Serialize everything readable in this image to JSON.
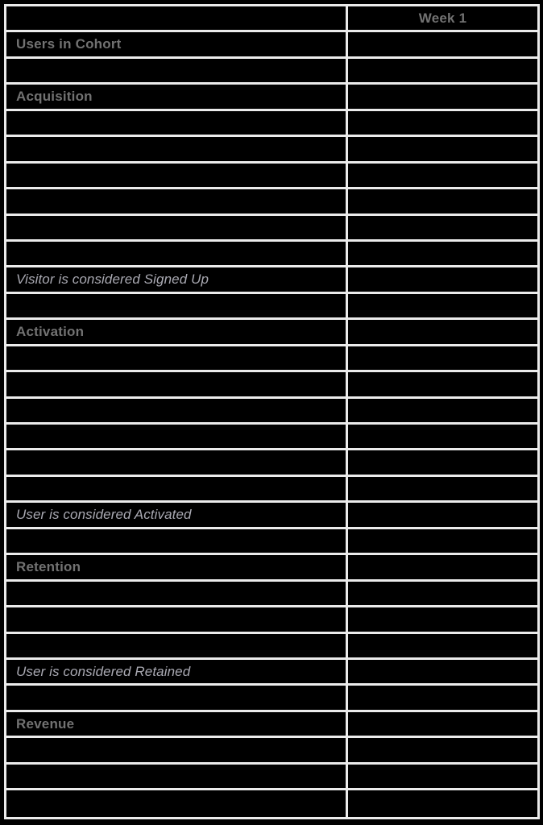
{
  "table": {
    "name": "cohort-funnel-metrics-table",
    "columns": [
      {
        "key": "label",
        "header": ""
      },
      {
        "key": "week1",
        "header": "Week 1"
      }
    ],
    "colors": {
      "background": "#000000",
      "gridline": "#ebebeb",
      "section_header_text": "#727272",
      "milestone_text": "#a9a9b2"
    },
    "rows": [
      {
        "style": "header",
        "label": "",
        "week1": "Week 1"
      },
      {
        "style": "section",
        "label": "Users in Cohort",
        "week1": ""
      },
      {
        "style": "blank",
        "label": "",
        "week1": ""
      },
      {
        "style": "section",
        "label": "Acquisition",
        "week1": ""
      },
      {
        "style": "blank",
        "label": "",
        "week1": ""
      },
      {
        "style": "blank",
        "label": "",
        "week1": ""
      },
      {
        "style": "blank",
        "label": "",
        "week1": ""
      },
      {
        "style": "blank",
        "label": "",
        "week1": ""
      },
      {
        "style": "blank",
        "label": "",
        "week1": ""
      },
      {
        "style": "blank",
        "label": "",
        "week1": ""
      },
      {
        "style": "milestone",
        "label": "Visitor is considered Signed Up",
        "week1": ""
      },
      {
        "style": "blank",
        "label": "",
        "week1": ""
      },
      {
        "style": "section",
        "label": "Activation",
        "week1": ""
      },
      {
        "style": "blank",
        "label": "",
        "week1": ""
      },
      {
        "style": "blank",
        "label": "",
        "week1": ""
      },
      {
        "style": "blank",
        "label": "",
        "week1": ""
      },
      {
        "style": "blank",
        "label": "",
        "week1": ""
      },
      {
        "style": "blank",
        "label": "",
        "week1": ""
      },
      {
        "style": "blank",
        "label": "",
        "week1": ""
      },
      {
        "style": "milestone",
        "label": "User is considered Activated",
        "week1": ""
      },
      {
        "style": "blank",
        "label": "",
        "week1": ""
      },
      {
        "style": "section",
        "label": "Retention",
        "week1": ""
      },
      {
        "style": "blank",
        "label": "",
        "week1": ""
      },
      {
        "style": "blank",
        "label": "",
        "week1": ""
      },
      {
        "style": "blank",
        "label": "",
        "week1": ""
      },
      {
        "style": "milestone",
        "label": "User is considered Retained",
        "week1": ""
      },
      {
        "style": "blank",
        "label": "",
        "week1": ""
      },
      {
        "style": "section",
        "label": "Revenue",
        "week1": ""
      },
      {
        "style": "blank",
        "label": "",
        "week1": ""
      },
      {
        "style": "blank",
        "label": "",
        "week1": ""
      },
      {
        "style": "blank",
        "label": "",
        "week1": ""
      }
    ]
  }
}
